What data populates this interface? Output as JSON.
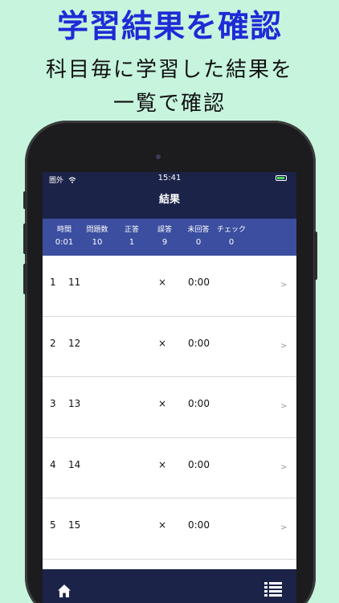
{
  "promo": {
    "title": "学習結果を確認",
    "subtitle_line1": "科目毎に学習した結果を",
    "subtitle_line2": "一覧で確認"
  },
  "status_bar": {
    "carrier": "圏外",
    "time": "15:41"
  },
  "nav": {
    "title": "結果"
  },
  "summary": [
    {
      "label": "時間",
      "value": "0:01"
    },
    {
      "label": "問題数",
      "value": "10"
    },
    {
      "label": "正答",
      "value": "1"
    },
    {
      "label": "誤答",
      "value": "9"
    },
    {
      "label": "未回答",
      "value": "0"
    },
    {
      "label": "チェック",
      "value": "0"
    }
  ],
  "rows": [
    {
      "index": "1",
      "question": "11",
      "result": "×",
      "time": "0:00",
      "chevron": ">"
    },
    {
      "index": "2",
      "question": "12",
      "result": "×",
      "time": "0:00",
      "chevron": ">"
    },
    {
      "index": "3",
      "question": "13",
      "result": "×",
      "time": "0:00",
      "chevron": ">"
    },
    {
      "index": "4",
      "question": "14",
      "result": "×",
      "time": "0:00",
      "chevron": ">"
    },
    {
      "index": "5",
      "question": "15",
      "result": "×",
      "time": "0:00",
      "chevron": ">"
    }
  ],
  "tabbar": {
    "left_icon": "home-icon",
    "right_icon": "list-icon"
  },
  "colors": {
    "background": "#c6f4dd",
    "title": "#1e2bd6",
    "nav": "#1b2348",
    "summary": "#3c4ea0"
  }
}
